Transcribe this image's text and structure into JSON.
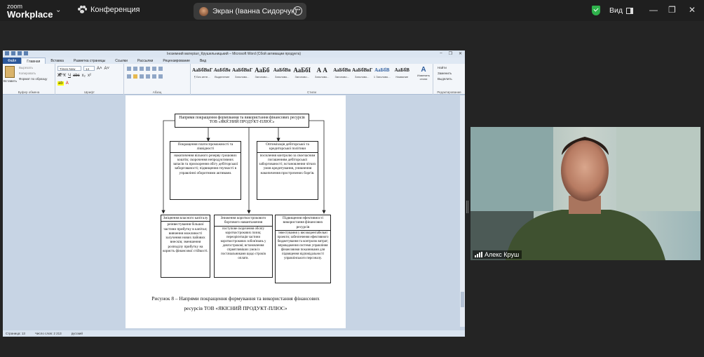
{
  "topbar": {
    "brand_small": "zoom",
    "brand_large": "Workplace",
    "meeting_label": "Конференция",
    "screen_share_tab": "Экран (Іванна Сидорчук)",
    "view_label": "Вид"
  },
  "word": {
    "title": "Іноземний матеріал_Крушельницький – Microsoft Word (Сбой активации продукта)",
    "tabs": [
      "Файл",
      "Главная",
      "Вставка",
      "Разметка страницы",
      "Ссылки",
      "Рассылки",
      "Рецензирование",
      "Вид"
    ],
    "clipboard": {
      "paste": "Вставить",
      "cut": "Вырезать",
      "copy": "Копировать",
      "format": "Формат по образцу",
      "label": "Буфер обмена"
    },
    "font": {
      "name": "Times New Ro",
      "size": "14",
      "label": "Шрифт"
    },
    "paragraph_label": "Абзац",
    "styles": [
      {
        "sample": "АаБбВвГ",
        "name": "¶ Без инте..."
      },
      {
        "sample": "АаБбВв",
        "name": "Выделение"
      },
      {
        "sample": "АаБбВвГ",
        "name": "Заголово..."
      },
      {
        "sample": "АаБб",
        "name": "Заголово..."
      },
      {
        "sample": "АаБбВв",
        "name": "Заголово..."
      },
      {
        "sample": "АаБбI",
        "name": "Заголово..."
      },
      {
        "sample": "А А",
        "name": "Заголово..."
      },
      {
        "sample": "АаБбВв",
        "name": "Заголово..."
      },
      {
        "sample": "АаБбВвГ",
        "name": "Заголово..."
      },
      {
        "sample": "АаБбВ",
        "name": "1 Заголово..."
      },
      {
        "sample": "АаБбВ",
        "name": "Название"
      }
    ],
    "styles_label": "Стили",
    "change_styles": "Изменить стили",
    "editing": {
      "find": "Найти",
      "replace": "Заменить",
      "select": "Выделить",
      "label": "Редактирование"
    },
    "status": {
      "page": "Страница: 13",
      "words": "Число слов: 2 213",
      "lang": "русский"
    }
  },
  "diagram": {
    "top": "Напрями покращення формування та використання фінансових ресурсів ТОВ «ЯКІСНИЙ ПРОДУКТ-ПЛЮС»",
    "mid_left": {
      "head": "Покращення платоспроможності та ліквідності",
      "body": "накопичення вільного резерву грошових коштів; скорочення непродуктивних запасів та прискорення обігу дебіторської заборгованості; підвищення гнучкості в управлінні оборотними активами."
    },
    "mid_right": {
      "head": "Оптимізація дебіторської та кредиторської політики",
      "body": "посилення контролю за своєчасним погашенням дебіторської заборгованості; встановлення чітких умов кредитування, уникнення накопичення прострочених боргів."
    },
    "bot_left": {
      "head": "Зміцнення власного капіталу",
      "body": "реінвестування більшої частини прибутку в капітал; вивчення можливості залучення нових пайових внесків; зменшення розподілу прибутку на користь фінансової стійкості."
    },
    "bot_mid": {
      "head": "Зниження короткострокового боргового навантаження",
      "body": "поступове скорочення обсягу короткострокових позик; переорієнтація частини короткострокових зобов'язань у довгострокові; встановлення сприятливіших умов із постачальниками щодо строків оплати."
    },
    "bot_right": {
      "head": "Підвищення ефективності використання фінансових ресурсів",
      "body": "інвестування у високорентабельні проекти; забезпечення ефективного бюджетування та контролю витрат; впровадження системи управління фінансовими показниками для підвищення відповідальності управлінського персоналу."
    },
    "caption_1": "Рисунок 8 – Напрями покращення формування та використання фінансових",
    "caption_2": "ресурсів ТОВ «ЯКІСНИЙ ПРОДУКТ-ПЛЮС»"
  },
  "participant": {
    "name": "Алекс Круш"
  }
}
